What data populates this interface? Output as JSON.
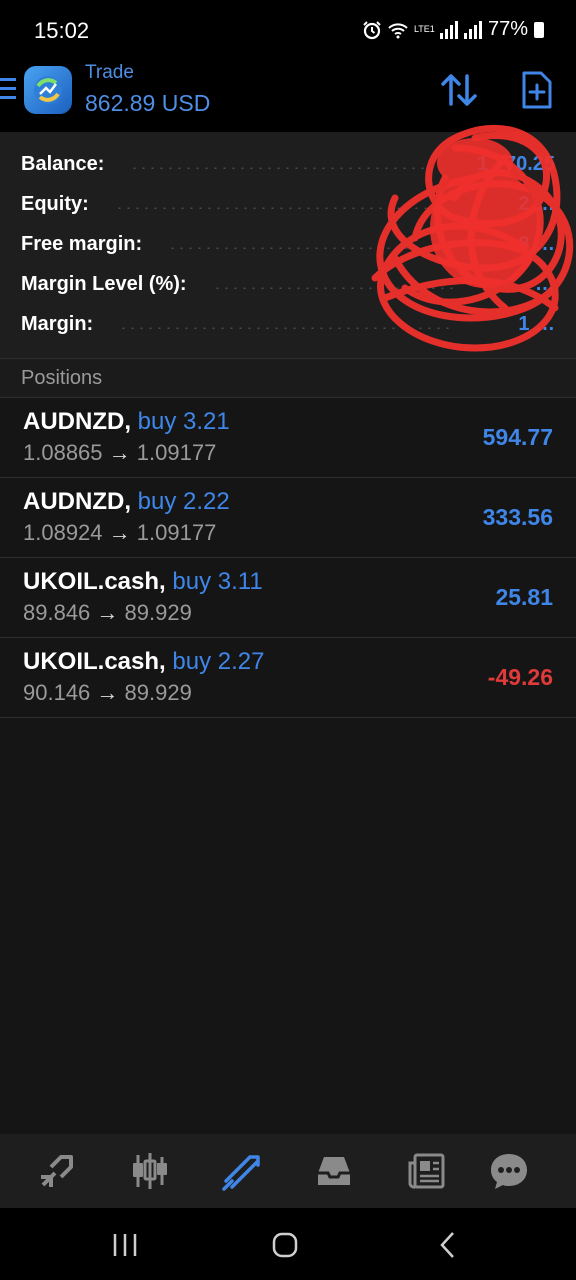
{
  "status_bar": {
    "time": "15:02",
    "battery": "77%",
    "network": "LTE1"
  },
  "header": {
    "title": "Trade",
    "subtitle": "862.89 USD"
  },
  "account": {
    "rows": [
      {
        "label": "Balance:",
        "value": "1 770.25"
      },
      {
        "label": "Equity:",
        "value": "2 …"
      },
      {
        "label": "Free margin:",
        "value": "8 …"
      },
      {
        "label": "Margin Level (%):",
        "value": "…"
      },
      {
        "label": "Margin:",
        "value": "1 …"
      }
    ]
  },
  "positions": {
    "title": "Positions",
    "items": [
      {
        "symbol": "AUDNZD,",
        "type": "buy 3.21",
        "open": "1.08865",
        "arrow": "→",
        "current": "1.09177",
        "profit": "594.77",
        "profit_color": "#3f86e8"
      },
      {
        "symbol": "AUDNZD,",
        "type": "buy 2.22",
        "open": "1.08924",
        "arrow": "→",
        "current": "1.09177",
        "profit": "333.56",
        "profit_color": "#3f86e8"
      },
      {
        "symbol": "UKOIL.cash,",
        "type": "buy 3.11",
        "open": "89.846",
        "arrow": "→",
        "current": "89.929",
        "profit": "25.81",
        "profit_color": "#3f86e8"
      },
      {
        "symbol": "UKOIL.cash,",
        "type": "buy 2.27",
        "open": "90.146",
        "arrow": "→",
        "current": "89.929",
        "profit": "-49.26",
        "profit_color": "#e03a3a"
      }
    ]
  },
  "bottom_nav": {
    "items": [
      {
        "icon": "quotes-icon"
      },
      {
        "icon": "chart-icon"
      },
      {
        "icon": "trade-icon",
        "active": true
      },
      {
        "icon": "history-icon"
      },
      {
        "icon": "news-icon"
      },
      {
        "icon": "messages-icon"
      }
    ]
  },
  "colors": {
    "accent": "#3f86e8",
    "loss": "#e03a3a",
    "muted": "#9a9a9a",
    "background": "#151515"
  }
}
